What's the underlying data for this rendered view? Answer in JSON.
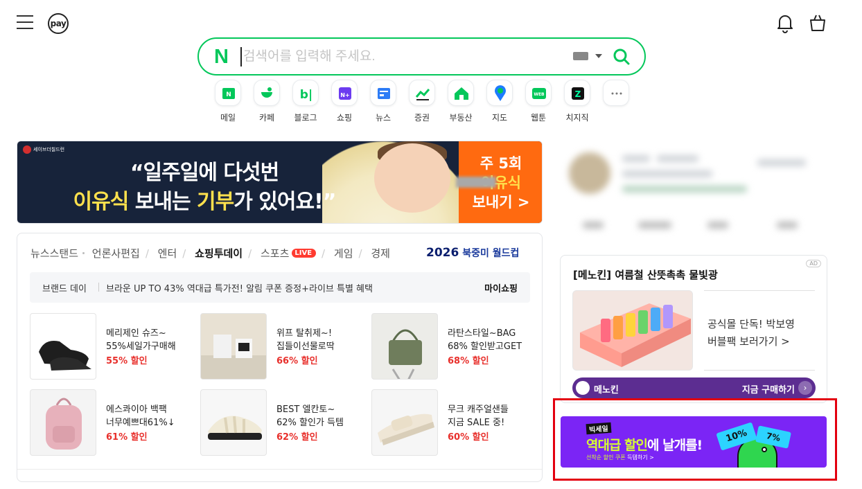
{
  "header": {
    "pay_label": "pay"
  },
  "search": {
    "logo": "N",
    "placeholder": "검색어를 입력해 주세요."
  },
  "shortcuts": [
    {
      "label": "메일",
      "icon": "mail-icon"
    },
    {
      "label": "카페",
      "icon": "cafe-icon"
    },
    {
      "label": "블로그",
      "icon": "blog-icon"
    },
    {
      "label": "쇼핑",
      "icon": "shopping-icon"
    },
    {
      "label": "뉴스",
      "icon": "news-icon"
    },
    {
      "label": "증권",
      "icon": "stock-icon"
    },
    {
      "label": "부동산",
      "icon": "realestate-icon"
    },
    {
      "label": "지도",
      "icon": "map-icon"
    },
    {
      "label": "웹툰",
      "icon": "webtoon-icon"
    },
    {
      "label": "치지직",
      "icon": "chzzk-icon"
    },
    {
      "label": "",
      "icon": "more-icon"
    }
  ],
  "banner": {
    "badge": "세이브더칠드런",
    "line1": "“일주일에 다섯번",
    "line2_hl1": "이유식",
    "line2_mid": " 보내는 ",
    "line2_hl2": "기부",
    "line2_end": "가 있어요!”",
    "cta_l1": "주 5회",
    "cta_l2": "이유식",
    "cta_l3": "보내기 >"
  },
  "news": {
    "tabs": [
      "뉴스스탠드",
      "언론사편집",
      "엔터",
      "쇼핑투데이",
      "스포츠",
      "게임",
      "경제"
    ],
    "active_tab": "쇼핑투데이",
    "live_badge": "LIVE",
    "worldcup_year": "2026",
    "worldcup_label": "북중미 월드컵",
    "brand_day": "브랜드 데이",
    "brand_text": "브라운 UP TO 43% 역대급 특가전! 알림 쿠폰 증정+라이브 특별 혜택",
    "my_shopping": "마이쇼핑",
    "products": [
      {
        "line1": "메리제인 슈즈~",
        "line2": "55%세일가구매해",
        "discount": "55% 할인"
      },
      {
        "line1": "위프 탈취제~!",
        "line2": "집들이선물로딱",
        "discount": "66% 할인"
      },
      {
        "line1": "라탄스타일~BAG",
        "line2": "68% 할인받고GET",
        "discount": "68% 할인"
      },
      {
        "line1": "에스콰이아 백팩",
        "line2": "너무예쁘대61%↓",
        "discount": "61% 할인"
      },
      {
        "line1": "BEST 엘칸토~",
        "line2": "62% 할인가 득템",
        "discount": "62% 할인"
      },
      {
        "line1": "무크 캐주얼샌들",
        "line2": "지금 SALE 중!",
        "discount": "60% 할인"
      }
    ]
  },
  "ad": {
    "tag": "AD",
    "title": "[메노킨] 여름철 산뜻촉촉 물빛광",
    "desc_l1": "공식몰 단독! 박보영",
    "desc_l2": "버블팩 보러가기 >",
    "brand": "메노킨",
    "buy_label": "지금 구매하기",
    "buy_arrow": "›"
  },
  "promo": {
    "logo": "빅세일",
    "title_hl": "역대급 할인",
    "title_rest": "에 날개를!",
    "sub_hl": "선착순 할인 쿠폰",
    "sub_rest": " 득템하기 >",
    "coupon1": "10%",
    "coupon2": "7%"
  },
  "colors": {
    "naver_green": "#03c75a",
    "discount_red": "#e8302c",
    "promo_purple": "#7b25f5",
    "highlight_red": "#e3000f"
  }
}
